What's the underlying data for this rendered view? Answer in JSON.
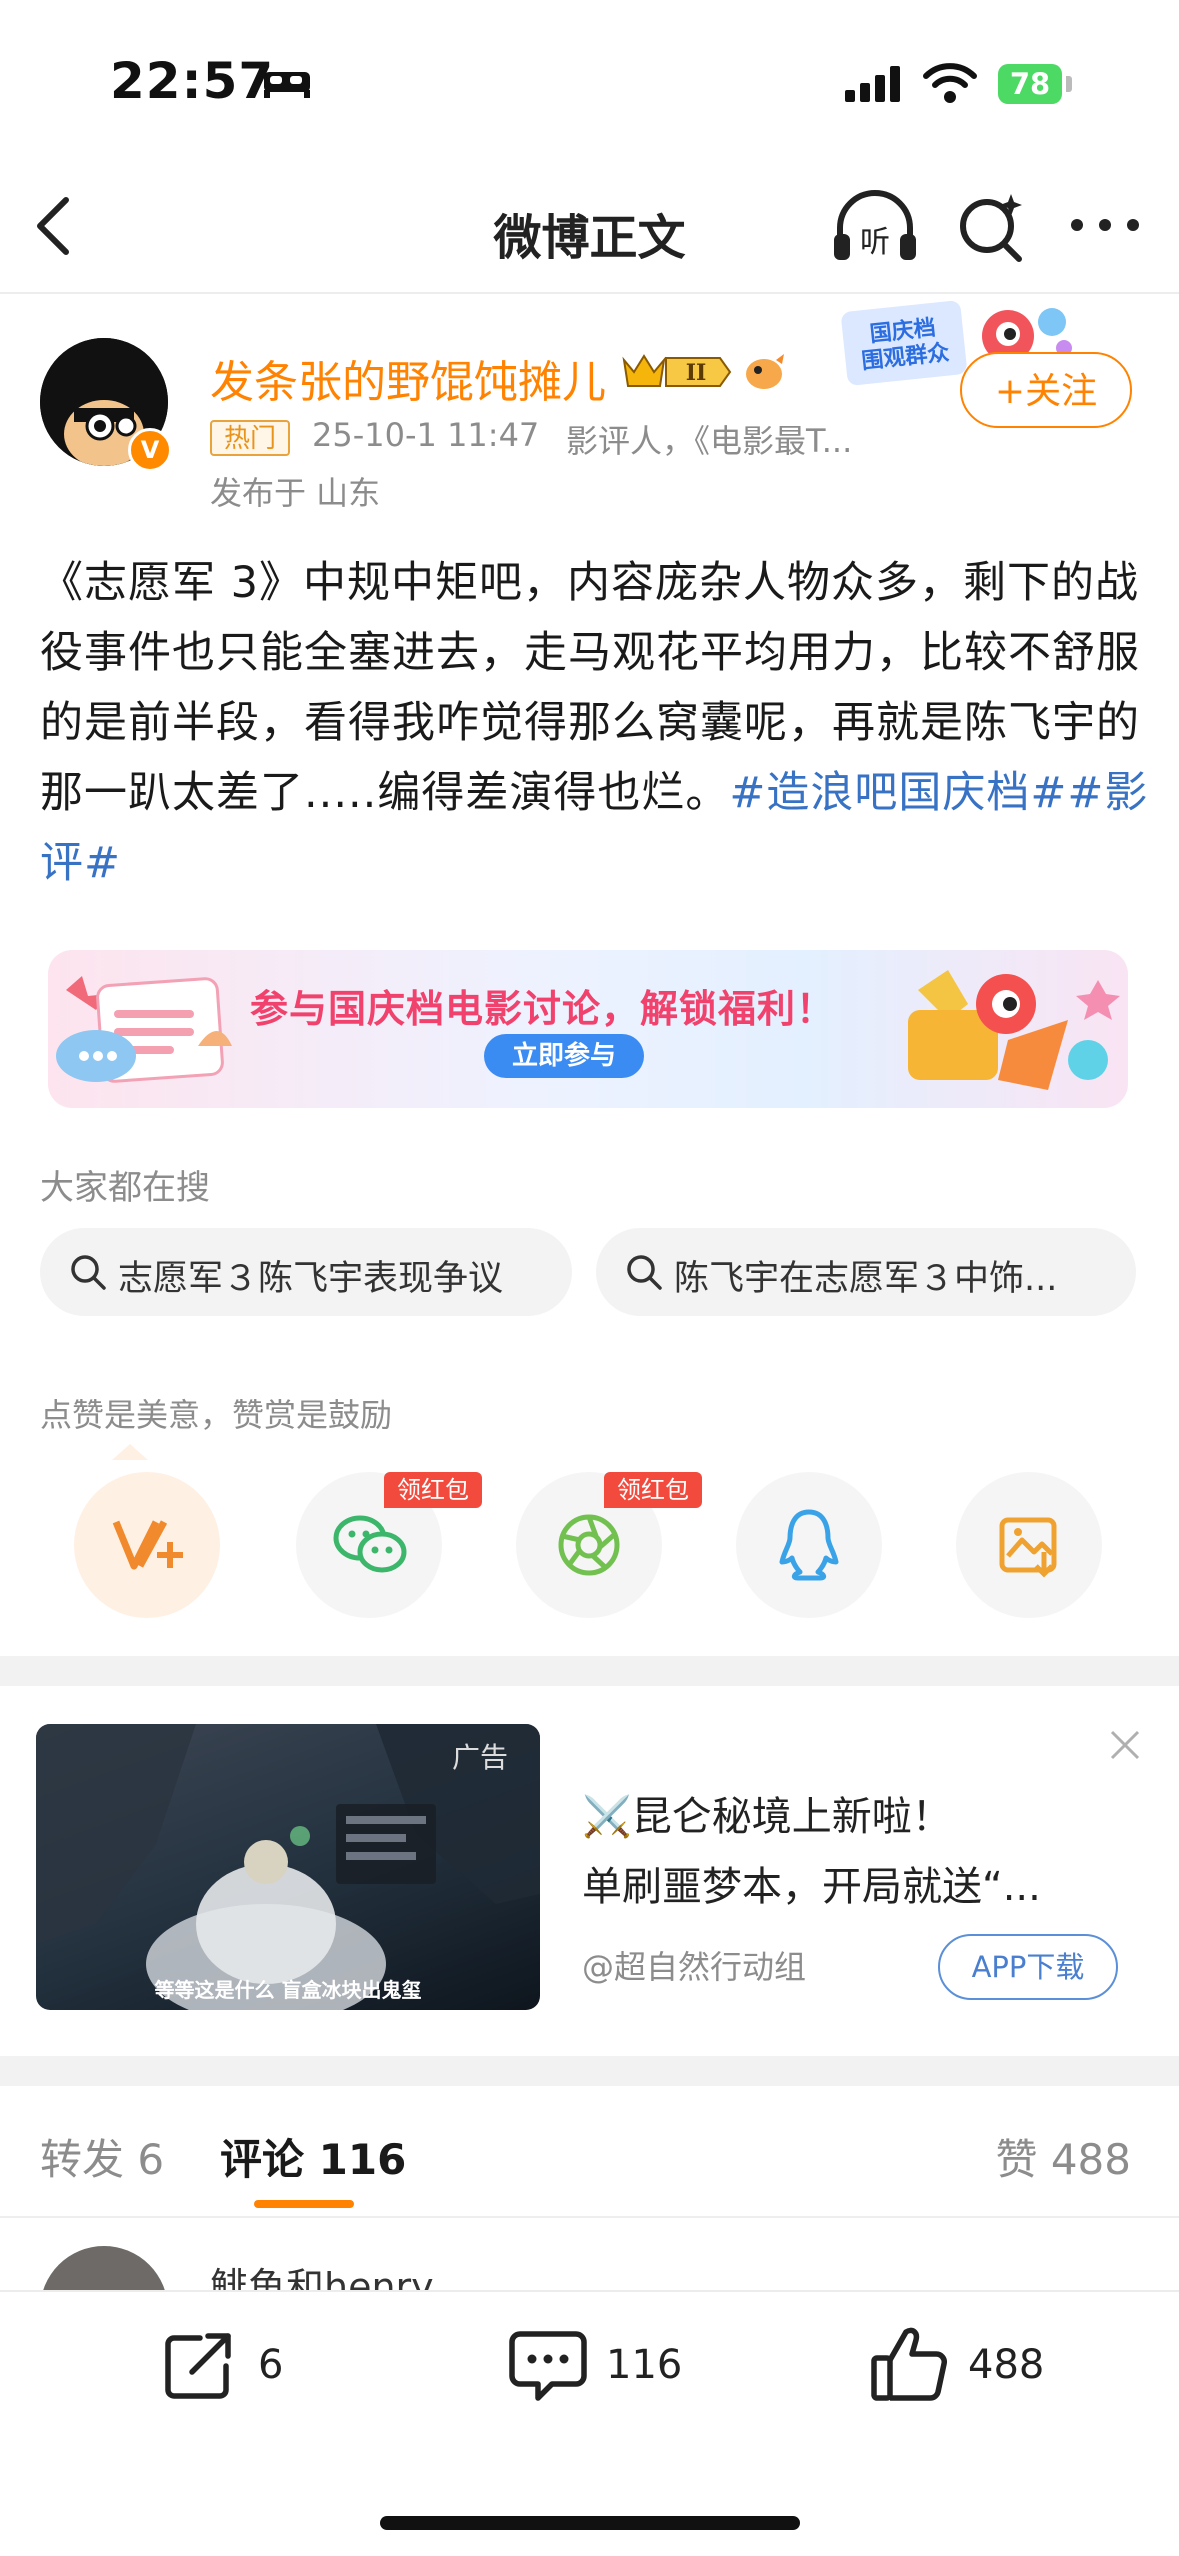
{
  "status_bar": {
    "time": "22:57",
    "battery": "78"
  },
  "nav": {
    "title": "微博正文"
  },
  "author": {
    "name": "发条张的野馄饨摊儿",
    "level_badge": "II",
    "event_badge": "国庆档\n围观群众",
    "follow_label": "+关注",
    "hot_tag": "热门",
    "time": "25-10-1 11:47",
    "source": "影评人，《电影最T...",
    "location": "发布于 山东"
  },
  "post": {
    "text": "《志愿军 3》中规中矩吧，内容庞杂人物众多，剩下的战役事件也只能全塞进去，走马观花平均用力，比较不舒服的是前半段，看得我咋觉得那么窝囊呢，再就是陈飞宇的那一趴太差了.....编得差演得也烂。",
    "hashtags": "#造浪吧国庆档##影评#"
  },
  "promo": {
    "title": "参与国庆档电影讨论，解锁福利！",
    "button": "立即参与"
  },
  "search_section": {
    "label": "大家都在搜",
    "chips": [
      "志愿军３陈飞宇表现争议",
      "陈飞宇在志愿军３中饰..."
    ]
  },
  "share_section": {
    "label": "点赞是美意，赞赏是鼓励",
    "red_tag": "领红包",
    "items": [
      "reward-icon",
      "wechat-icon",
      "moments-icon",
      "qq-icon",
      "save-image-icon"
    ]
  },
  "ad": {
    "tag": "广告",
    "caption": "等等这是什么 盲盒冰块出鬼玺",
    "line1": "⚔️昆仑秘境上新啦！",
    "line2": "单刷噩梦本，开局就送“...",
    "advertiser": "@超自然行动组",
    "button": "APP下载"
  },
  "tabs": {
    "forward": "转发 6",
    "comments": "评论 116",
    "likes": "赞 488"
  },
  "first_comment": {
    "user": "鲱鱼和henry"
  },
  "bottom_bar": {
    "forward_count": "6",
    "comment_count": "116",
    "like_count": "488"
  },
  "colors": {
    "accent": "#ff8200",
    "link": "#3872c4",
    "red": "#f24b3e"
  }
}
